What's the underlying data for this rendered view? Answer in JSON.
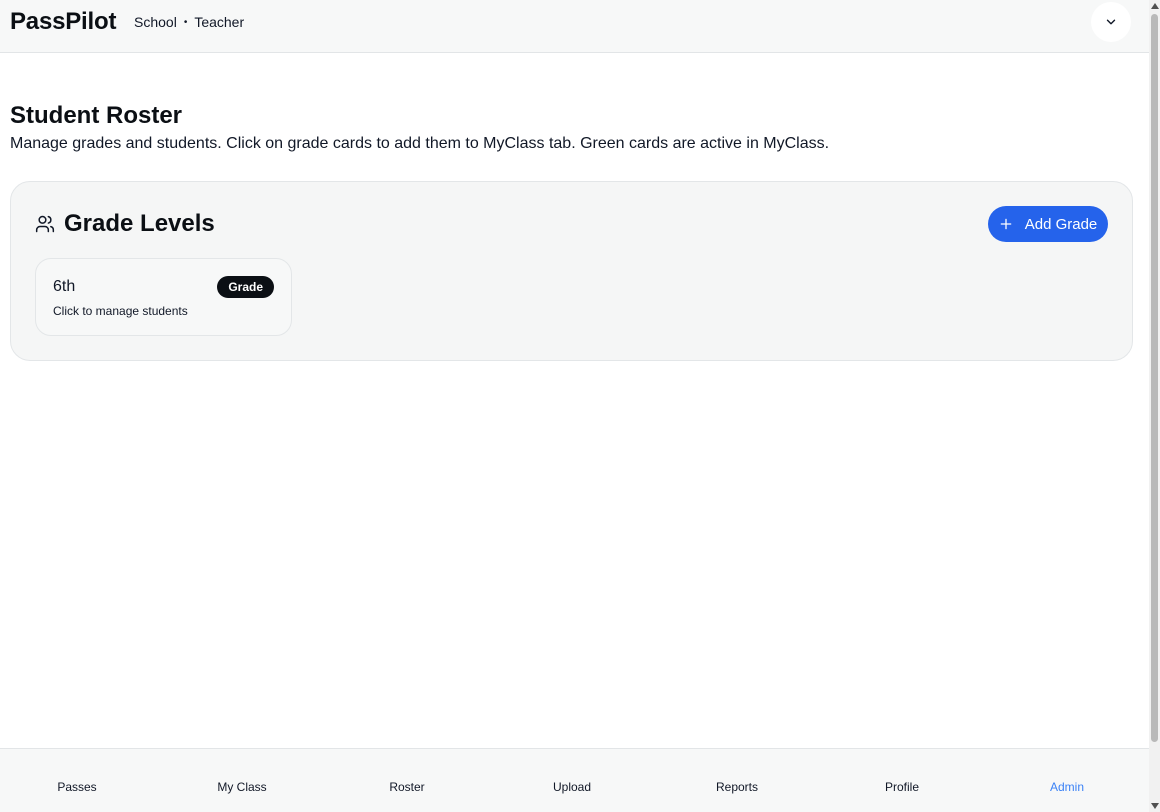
{
  "header": {
    "brand": "PassPilot",
    "school": "School",
    "separator": "•",
    "role": "Teacher",
    "menu_icon": "chevron-down-icon"
  },
  "page": {
    "title": "Student Roster",
    "description": "Manage grades and students. Click on grade cards to add them to MyClass tab. Green cards are active in MyClass."
  },
  "grade_panel": {
    "icon": "users-icon",
    "title": "Grade Levels",
    "add_button": {
      "icon": "plus-icon",
      "label": "Add Grade"
    },
    "grades": [
      {
        "name": "6th",
        "badge": "Grade",
        "subtitle": "Click to manage students"
      }
    ]
  },
  "bottom_nav": {
    "items": [
      {
        "label": "Passes",
        "active": false
      },
      {
        "label": "My Class",
        "active": false
      },
      {
        "label": "Roster",
        "active": false
      },
      {
        "label": "Upload",
        "active": false
      },
      {
        "label": "Reports",
        "active": false
      },
      {
        "label": "Profile",
        "active": false
      },
      {
        "label": "Admin",
        "active": true
      }
    ]
  },
  "colors": {
    "accent": "#2563eb",
    "active_nav": "#3b82f6",
    "badge_bg": "#0b0f14",
    "panel_bg": "#f5f6f6"
  }
}
